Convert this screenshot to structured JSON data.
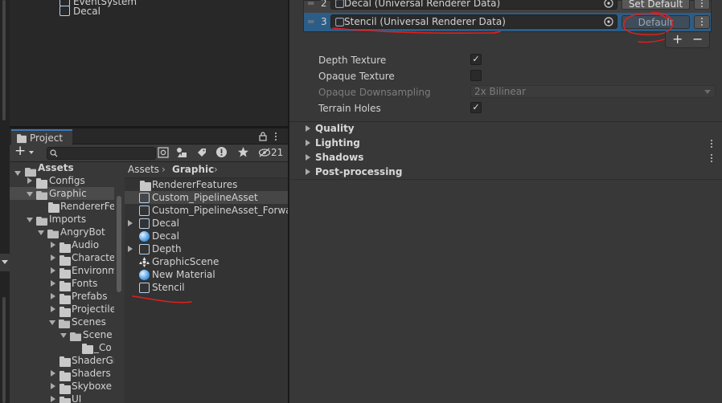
{
  "hierarchy": {
    "items": [
      {
        "label": "EventSystem"
      },
      {
        "label": "Decal"
      }
    ]
  },
  "project": {
    "tab_label": "Project",
    "add_label": "+",
    "hidden_count": "21",
    "tree": [
      {
        "label": "Assets"
      },
      {
        "label": "Configs"
      },
      {
        "label": "Graphic"
      },
      {
        "label": "RendererFe"
      },
      {
        "label": "Imports"
      },
      {
        "label": "AngryBot"
      },
      {
        "label": "Audio"
      },
      {
        "label": "Characte"
      },
      {
        "label": "Environm"
      },
      {
        "label": "Fonts"
      },
      {
        "label": "Prefabs"
      },
      {
        "label": "Projectile"
      },
      {
        "label": "Scenes"
      },
      {
        "label": "Scene"
      },
      {
        "label": "_Co"
      },
      {
        "label": "ShaderGr"
      },
      {
        "label": "Shaders"
      },
      {
        "label": "Skyboxe"
      },
      {
        "label": "UI"
      }
    ],
    "breadcrumb": {
      "root": "Assets",
      "current": "Graphic"
    },
    "files": [
      {
        "label": "RendererFeatures",
        "icon": "folder-icon"
      },
      {
        "label": "Custom_PipelineAsset",
        "icon": "pipeline-asset-icon"
      },
      {
        "label": "Custom_PipelineAsset_Forwar",
        "icon": "pipeline-asset-icon"
      },
      {
        "label": "Decal",
        "icon": "renderer-data-icon"
      },
      {
        "label": "Decal",
        "icon": "material-icon"
      },
      {
        "label": "Depth",
        "icon": "renderer-data-icon"
      },
      {
        "label": "GraphicScene",
        "icon": "unity-scene-icon"
      },
      {
        "label": "New Material",
        "icon": "material-icon"
      },
      {
        "label": "Stencil",
        "icon": "renderer-data-icon"
      }
    ]
  },
  "inspector": {
    "renderer_list": [
      {
        "index": "2",
        "label": "Decal (Universal Renderer Data)",
        "button": "Set Default"
      },
      {
        "index": "3",
        "label": "Stencil (Universal Renderer Data)",
        "button": "Default"
      }
    ],
    "list_add": "+",
    "list_remove": "−",
    "props": [
      {
        "label": "Depth Texture",
        "checked": "✓"
      },
      {
        "label": "Opaque Texture",
        "checked": ""
      },
      {
        "label": "Opaque Downsampling",
        "value": "2x Bilinear"
      },
      {
        "label": "Terrain Holes",
        "checked": "✓"
      }
    ],
    "sections": [
      {
        "label": "Quality"
      },
      {
        "label": "Lighting"
      },
      {
        "label": "Shadows"
      },
      {
        "label": "Post-processing"
      }
    ]
  },
  "colors": {
    "annotation": "#e0201c",
    "selection": "#2c5d87",
    "accent": "#3a79bb"
  }
}
